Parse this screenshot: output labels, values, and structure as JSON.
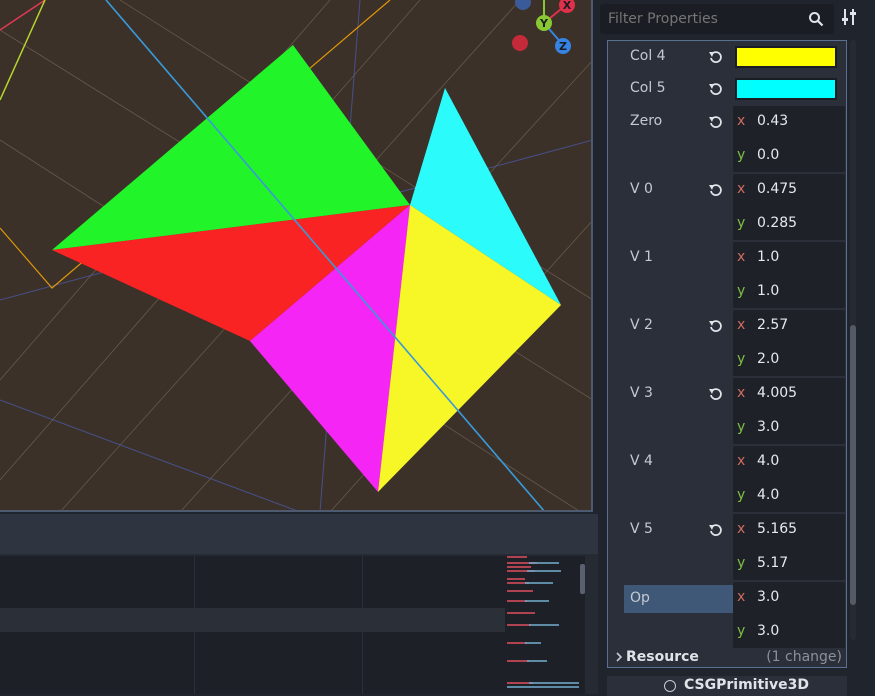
{
  "viewport": {
    "gizmo": {
      "x_label": "X",
      "y_label": "Y",
      "z_label": "Z"
    },
    "shape_colors": {
      "green": "#22f42a",
      "cyan": "#2bfbfb",
      "red": "#fa2323",
      "magenta": "#f525f5",
      "yellow": "#f7f728"
    }
  },
  "inspector": {
    "filter": {
      "placeholder": "Filter Properties"
    },
    "properties": {
      "col4": {
        "label": "Col 4",
        "color": "#ffff00"
      },
      "col5": {
        "label": "Col 5",
        "color": "#00ffff"
      },
      "zero": {
        "label": "Zero",
        "x": "0.43",
        "y": "0.0"
      },
      "v0": {
        "label": "V 0",
        "x": "0.475",
        "y": "0.285"
      },
      "v1": {
        "label": "V 1",
        "x": "1.0",
        "y": "1.0"
      },
      "v2": {
        "label": "V 2",
        "x": "2.57",
        "y": "2.0"
      },
      "v3": {
        "label": "V 3",
        "x": "4.005",
        "y": "3.0"
      },
      "v4": {
        "label": "V 4",
        "x": "4.0",
        "y": "4.0"
      },
      "v5": {
        "label": "V 5",
        "x": "5.165",
        "y": "5.17"
      },
      "op": {
        "label": "Op",
        "x": "3.0",
        "y": "3.0"
      }
    },
    "axis_labels": {
      "x": "x",
      "y": "y"
    },
    "resource": {
      "label": "Resource",
      "changes": "(1 change)"
    },
    "node": {
      "label": "CSGPrimitive3D"
    }
  }
}
